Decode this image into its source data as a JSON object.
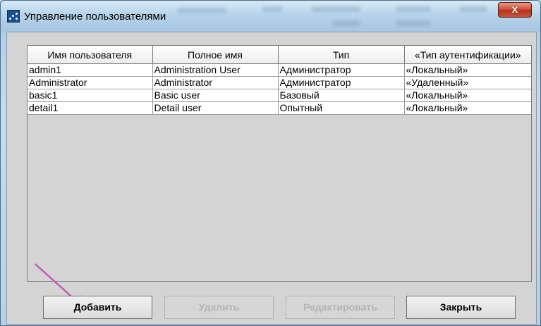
{
  "window": {
    "title": "Управление пользователями",
    "close_glyph": "x"
  },
  "table": {
    "columns": [
      "Имя пользователя",
      "Полное имя",
      "Тип",
      "«Тип аутентификации»"
    ],
    "rows": [
      [
        "admin1",
        "Administration User",
        "Администратор",
        "«Локальный»"
      ],
      [
        "Administrator",
        "Administrator",
        "Администратор",
        "«Удаленный»"
      ],
      [
        "basic1",
        "Basic user",
        "Базовый",
        "«Локальный»"
      ],
      [
        "detail1",
        "Detail user",
        "Опытный",
        "«Локальный»"
      ]
    ]
  },
  "buttons": {
    "add": "Добавить",
    "delete": "Удалить",
    "edit": "Редактировать",
    "close": "Закрыть"
  },
  "colors": {
    "annotation_arrow": "#c15bb5",
    "close_button": "#c8553c"
  }
}
